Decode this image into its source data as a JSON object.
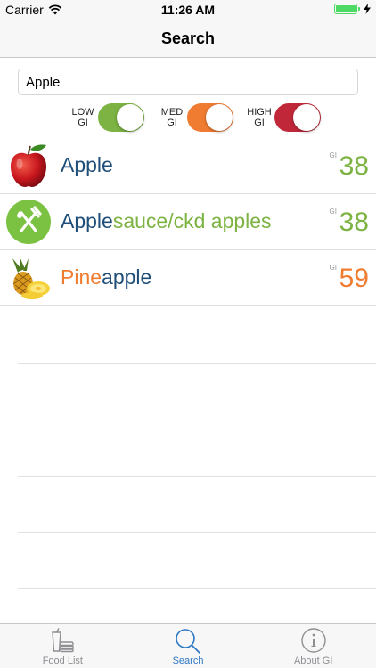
{
  "status_bar": {
    "carrier": "Carrier",
    "time": "11:26 AM"
  },
  "nav": {
    "title": "Search"
  },
  "search": {
    "value": "Apple",
    "placeholder": ""
  },
  "filters": [
    {
      "label_line1": "LOW",
      "label_line2": "GI",
      "on": true,
      "color": "#7cb342"
    },
    {
      "label_line1": "MED",
      "label_line2": "GI",
      "on": true,
      "color": "#f07c31"
    },
    {
      "label_line1": "HIGH",
      "label_line2": "GI",
      "on": true,
      "color": "#c0283a"
    }
  ],
  "results": [
    {
      "name_plain_prefix": "",
      "name_match": "Apple",
      "name_rest": "",
      "gi_tag": "GI",
      "gi": "38",
      "match_color": "#1f4e79",
      "rest_color": "#1f4e79",
      "gi_color": "#7cb342",
      "icon": "apple-image"
    },
    {
      "name_plain_prefix": "",
      "name_match": "Apple",
      "name_rest": "sauce/ckd apples",
      "gi_tag": "GI",
      "gi": "38",
      "match_color": "#1f4e79",
      "rest_color": "#7cb342",
      "gi_color": "#7cb342",
      "icon": "fork-knife-icon"
    },
    {
      "name_plain_prefix": "Pine",
      "name_match": "apple",
      "name_rest": "",
      "gi_tag": "GI",
      "gi": "59",
      "match_color": "#1f4e79",
      "prefix_color": "#f07c31",
      "gi_color": "#f07c31",
      "icon": "pineapple-image"
    }
  ],
  "tabs": [
    {
      "label": "Food List",
      "icon": "food-list-icon",
      "active": false
    },
    {
      "label": "Search",
      "icon": "search-icon",
      "active": true
    },
    {
      "label": "About GI",
      "icon": "info-icon",
      "active": false
    }
  ]
}
